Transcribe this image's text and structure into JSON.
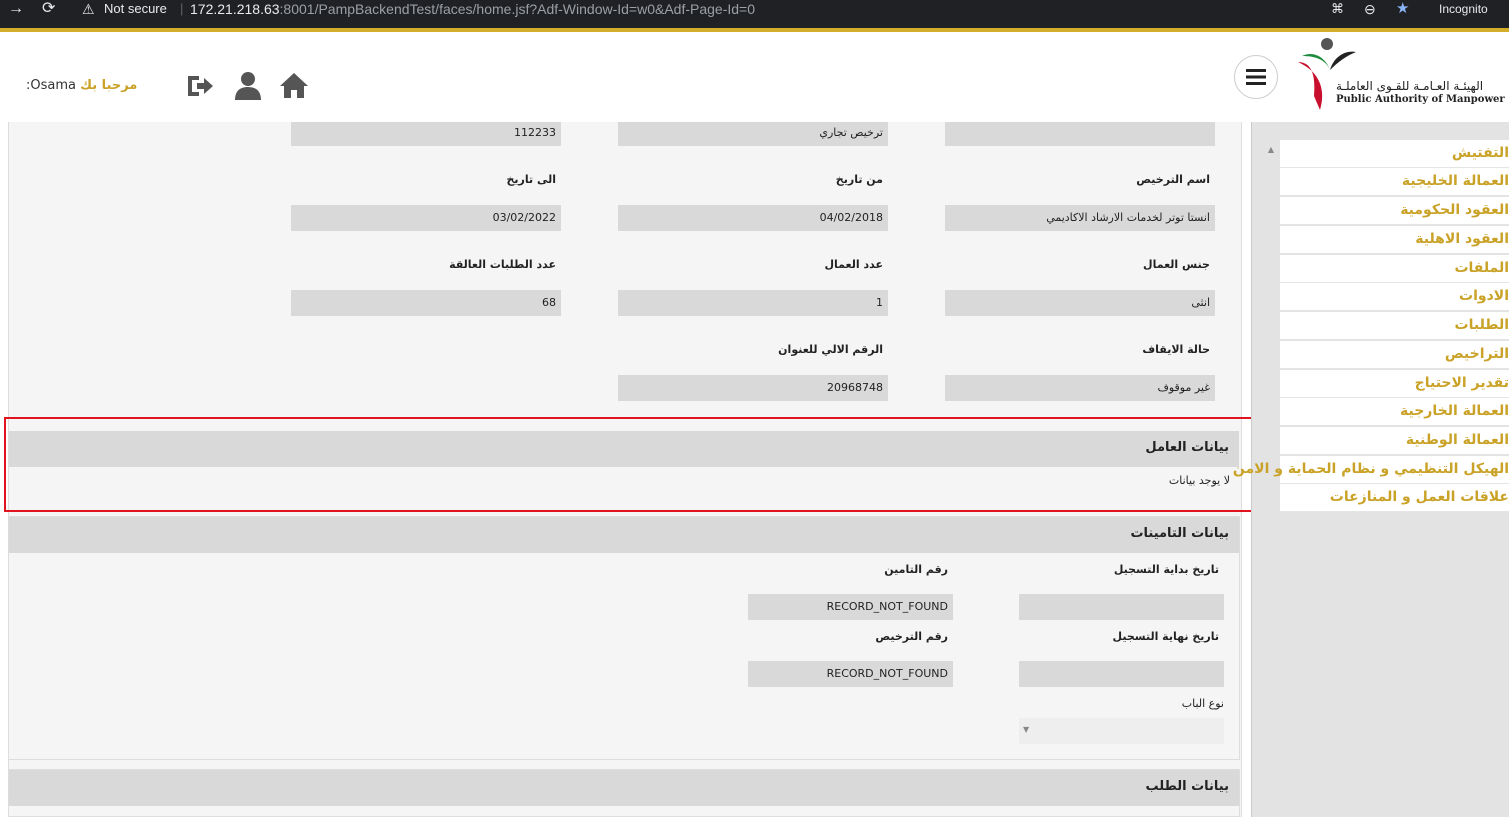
{
  "browser": {
    "security_label": "Not secure",
    "url_host": "172.21.218.63",
    "url_rest": ":8001/PampBackendTest/faces/home.jsf?Adf-Window-Id=w0&Adf-Page-Id=0",
    "incognito_label": "Incognito"
  },
  "header": {
    "welcome_greeting": "مرحبا بك",
    "welcome_user": "Osama:",
    "logo_arabic": "الهيئـة العـامـة للقـوى العاملـة",
    "logo_english": "Public Authority of Manpower"
  },
  "license_fields": {
    "row0": {
      "col1_value": "112233",
      "col2_value": "ترخيص تجاري",
      "col3_value": ""
    },
    "row1": {
      "col1_label": "الى تاريخ",
      "col1_value": "03/02/2022",
      "col2_label": "من تاريخ",
      "col2_value": "04/02/2018",
      "col3_label": "اسم الترخيص",
      "col3_value": "انستا توتر لخدمات الارشاد الاكاديمي"
    },
    "row2": {
      "col1_label": "عدد الطلبات العالقة",
      "col1_value": "68",
      "col2_label": "عدد العمال",
      "col2_value": "1",
      "col3_label": "جنس العمال",
      "col3_value": "انثى"
    },
    "row3": {
      "col2_label": "الرقم الالي للعنوان",
      "col2_value": "20968748",
      "col3_label": "حالة الايقاف",
      "col3_value": "غير موقوف"
    }
  },
  "worker_section": {
    "title": "بيانات العامل",
    "empty_message": "لا يوجد بيانات"
  },
  "insurance_section": {
    "title": "بيانات التامينات",
    "reg_start_label": "تاريخ بداية التسجيل",
    "reg_start_value": "",
    "insurance_no_label": "رقم التامين",
    "insurance_no_value": "RECORD_NOT_FOUND",
    "reg_end_label": "تاريخ نهاية التسجيل",
    "reg_end_value": "",
    "license_no_label": "رقم الترخيص",
    "license_no_value": "RECORD_NOT_FOUND",
    "gate_type_label": "نوع الباب",
    "gate_type_value": ""
  },
  "request_section": {
    "title": "بيانات الطلب"
  },
  "sidebar": {
    "items": [
      {
        "label": "التفتيش"
      },
      {
        "label": "العمالة الخليجية"
      },
      {
        "label": "العقود الحكومية"
      },
      {
        "label": "العقود الاهلية"
      },
      {
        "label": "الملفات"
      },
      {
        "label": "الادوات"
      },
      {
        "label": "الطلبات"
      },
      {
        "label": "التراخيص"
      },
      {
        "label": "تقدير الاحتياج"
      },
      {
        "label": "العمالة الخارجية"
      },
      {
        "label": "العمالة الوطنية"
      },
      {
        "label": "الهيكل التنظيمي و نظام الحماية و الامن"
      },
      {
        "label": "علاقات العمل و المنازعات"
      }
    ]
  },
  "colors": {
    "accent_gold": "#c9a227",
    "highlight_red": "#e0141e"
  }
}
